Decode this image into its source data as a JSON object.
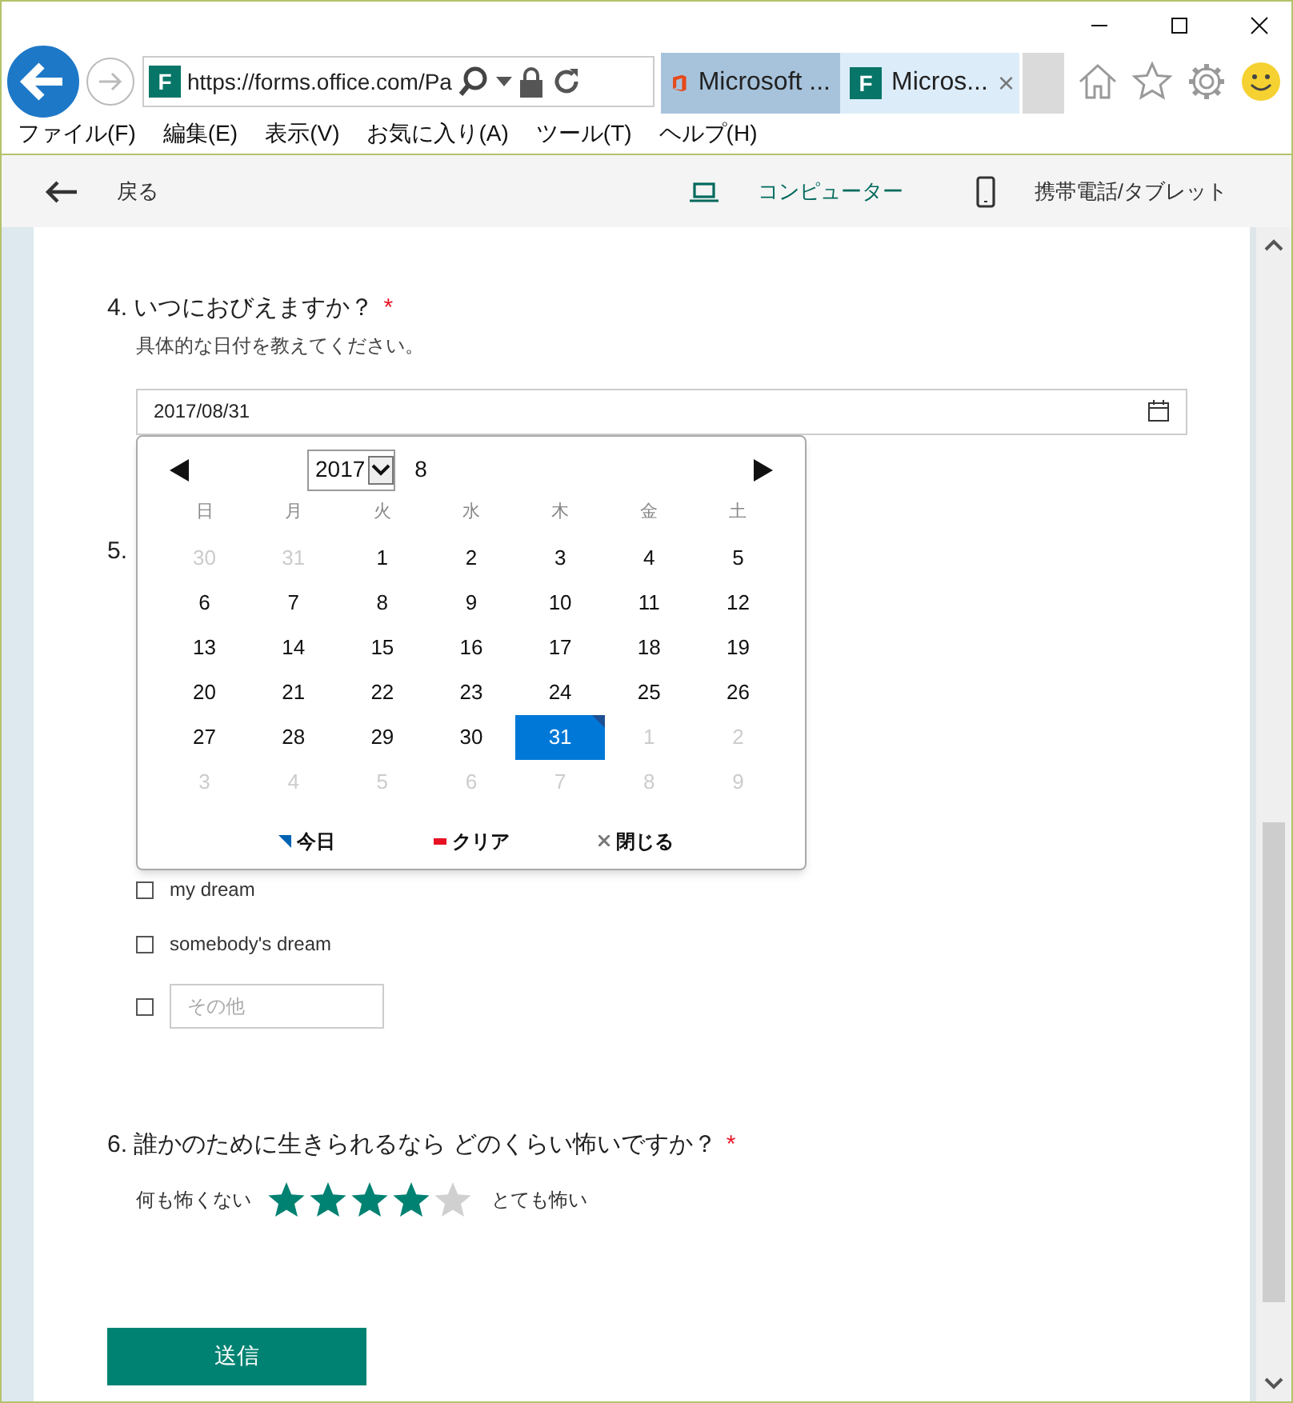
{
  "browser": {
    "logo": "F",
    "address": "https://forms.office.com/Pa",
    "tabs": [
      {
        "label": "Microsoft ...",
        "selected": false,
        "kind": "office"
      },
      {
        "label": "Micros...",
        "selected": true,
        "kind": "forms",
        "logo": "F"
      }
    ],
    "close_tab": "×"
  },
  "menu": [
    "ファイル(F)",
    "編集(E)",
    "表示(V)",
    "お気に入り(A)",
    "ツール(T)",
    "ヘルプ(H)"
  ],
  "toolbar": {
    "back": "戻る",
    "views": [
      {
        "label": "コンピューター",
        "selected": true,
        "kind": "laptop"
      },
      {
        "label": "携帯電話/タブレット",
        "selected": false,
        "kind": "phone"
      }
    ]
  },
  "q4": {
    "title": "4. いつにおびえますか？",
    "required_mark": "*",
    "subtitle": "具体的な日付を教えてください。",
    "value": "2017/08/31"
  },
  "calendar": {
    "year": "2017",
    "month": "8",
    "weekdays": [
      "日",
      "月",
      "火",
      "水",
      "木",
      "金",
      "土"
    ],
    "weeks": [
      [
        {
          "day": "30",
          "in_month": false,
          "selected": false
        },
        {
          "day": "31",
          "in_month": false,
          "selected": false
        },
        {
          "day": "1",
          "in_month": true,
          "selected": false
        },
        {
          "day": "2",
          "in_month": true,
          "selected": false
        },
        {
          "day": "3",
          "in_month": true,
          "selected": false
        },
        {
          "day": "4",
          "in_month": true,
          "selected": false
        },
        {
          "day": "5",
          "in_month": true,
          "selected": false
        }
      ],
      [
        {
          "day": "6",
          "in_month": true,
          "selected": false
        },
        {
          "day": "7",
          "in_month": true,
          "selected": false
        },
        {
          "day": "8",
          "in_month": true,
          "selected": false
        },
        {
          "day": "9",
          "in_month": true,
          "selected": false
        },
        {
          "day": "10",
          "in_month": true,
          "selected": false
        },
        {
          "day": "11",
          "in_month": true,
          "selected": false
        },
        {
          "day": "12",
          "in_month": true,
          "selected": false
        }
      ],
      [
        {
          "day": "13",
          "in_month": true,
          "selected": false
        },
        {
          "day": "14",
          "in_month": true,
          "selected": false
        },
        {
          "day": "15",
          "in_month": true,
          "selected": false
        },
        {
          "day": "16",
          "in_month": true,
          "selected": false
        },
        {
          "day": "17",
          "in_month": true,
          "selected": false
        },
        {
          "day": "18",
          "in_month": true,
          "selected": false
        },
        {
          "day": "19",
          "in_month": true,
          "selected": false
        }
      ],
      [
        {
          "day": "20",
          "in_month": true,
          "selected": false
        },
        {
          "day": "21",
          "in_month": true,
          "selected": false
        },
        {
          "day": "22",
          "in_month": true,
          "selected": false
        },
        {
          "day": "23",
          "in_month": true,
          "selected": false
        },
        {
          "day": "24",
          "in_month": true,
          "selected": false
        },
        {
          "day": "25",
          "in_month": true,
          "selected": false
        },
        {
          "day": "26",
          "in_month": true,
          "selected": false
        }
      ],
      [
        {
          "day": "27",
          "in_month": true,
          "selected": false
        },
        {
          "day": "28",
          "in_month": true,
          "selected": false
        },
        {
          "day": "29",
          "in_month": true,
          "selected": false
        },
        {
          "day": "30",
          "in_month": true,
          "selected": false
        },
        {
          "day": "31",
          "in_month": true,
          "selected": true
        },
        {
          "day": "1",
          "in_month": false,
          "selected": false
        },
        {
          "day": "2",
          "in_month": false,
          "selected": false
        }
      ],
      [
        {
          "day": "3",
          "in_month": false,
          "selected": false
        },
        {
          "day": "4",
          "in_month": false,
          "selected": false
        },
        {
          "day": "5",
          "in_month": false,
          "selected": false
        },
        {
          "day": "6",
          "in_month": false,
          "selected": false
        },
        {
          "day": "7",
          "in_month": false,
          "selected": false
        },
        {
          "day": "8",
          "in_month": false,
          "selected": false
        },
        {
          "day": "9",
          "in_month": false,
          "selected": false
        }
      ]
    ],
    "footer": [
      {
        "label": "今日",
        "kind": "today"
      },
      {
        "label": "クリア",
        "kind": "clear"
      },
      {
        "label": "閉じる",
        "kind": "close"
      }
    ]
  },
  "q5": {
    "title": "5.",
    "options": [
      {
        "label": "my dream",
        "checked": false,
        "kind": "text"
      },
      {
        "label": "somebody's dream",
        "checked": false,
        "kind": "text"
      },
      {
        "placeholder": "その他",
        "checked": false,
        "kind": "other"
      }
    ]
  },
  "q6": {
    "title": "6. 誰かのために生きられるなら どのくらい怖いですか？",
    "required_mark": "*",
    "low": "何も怖くない",
    "high": "とても怖い",
    "stars": 4
  },
  "submit": "送信"
}
